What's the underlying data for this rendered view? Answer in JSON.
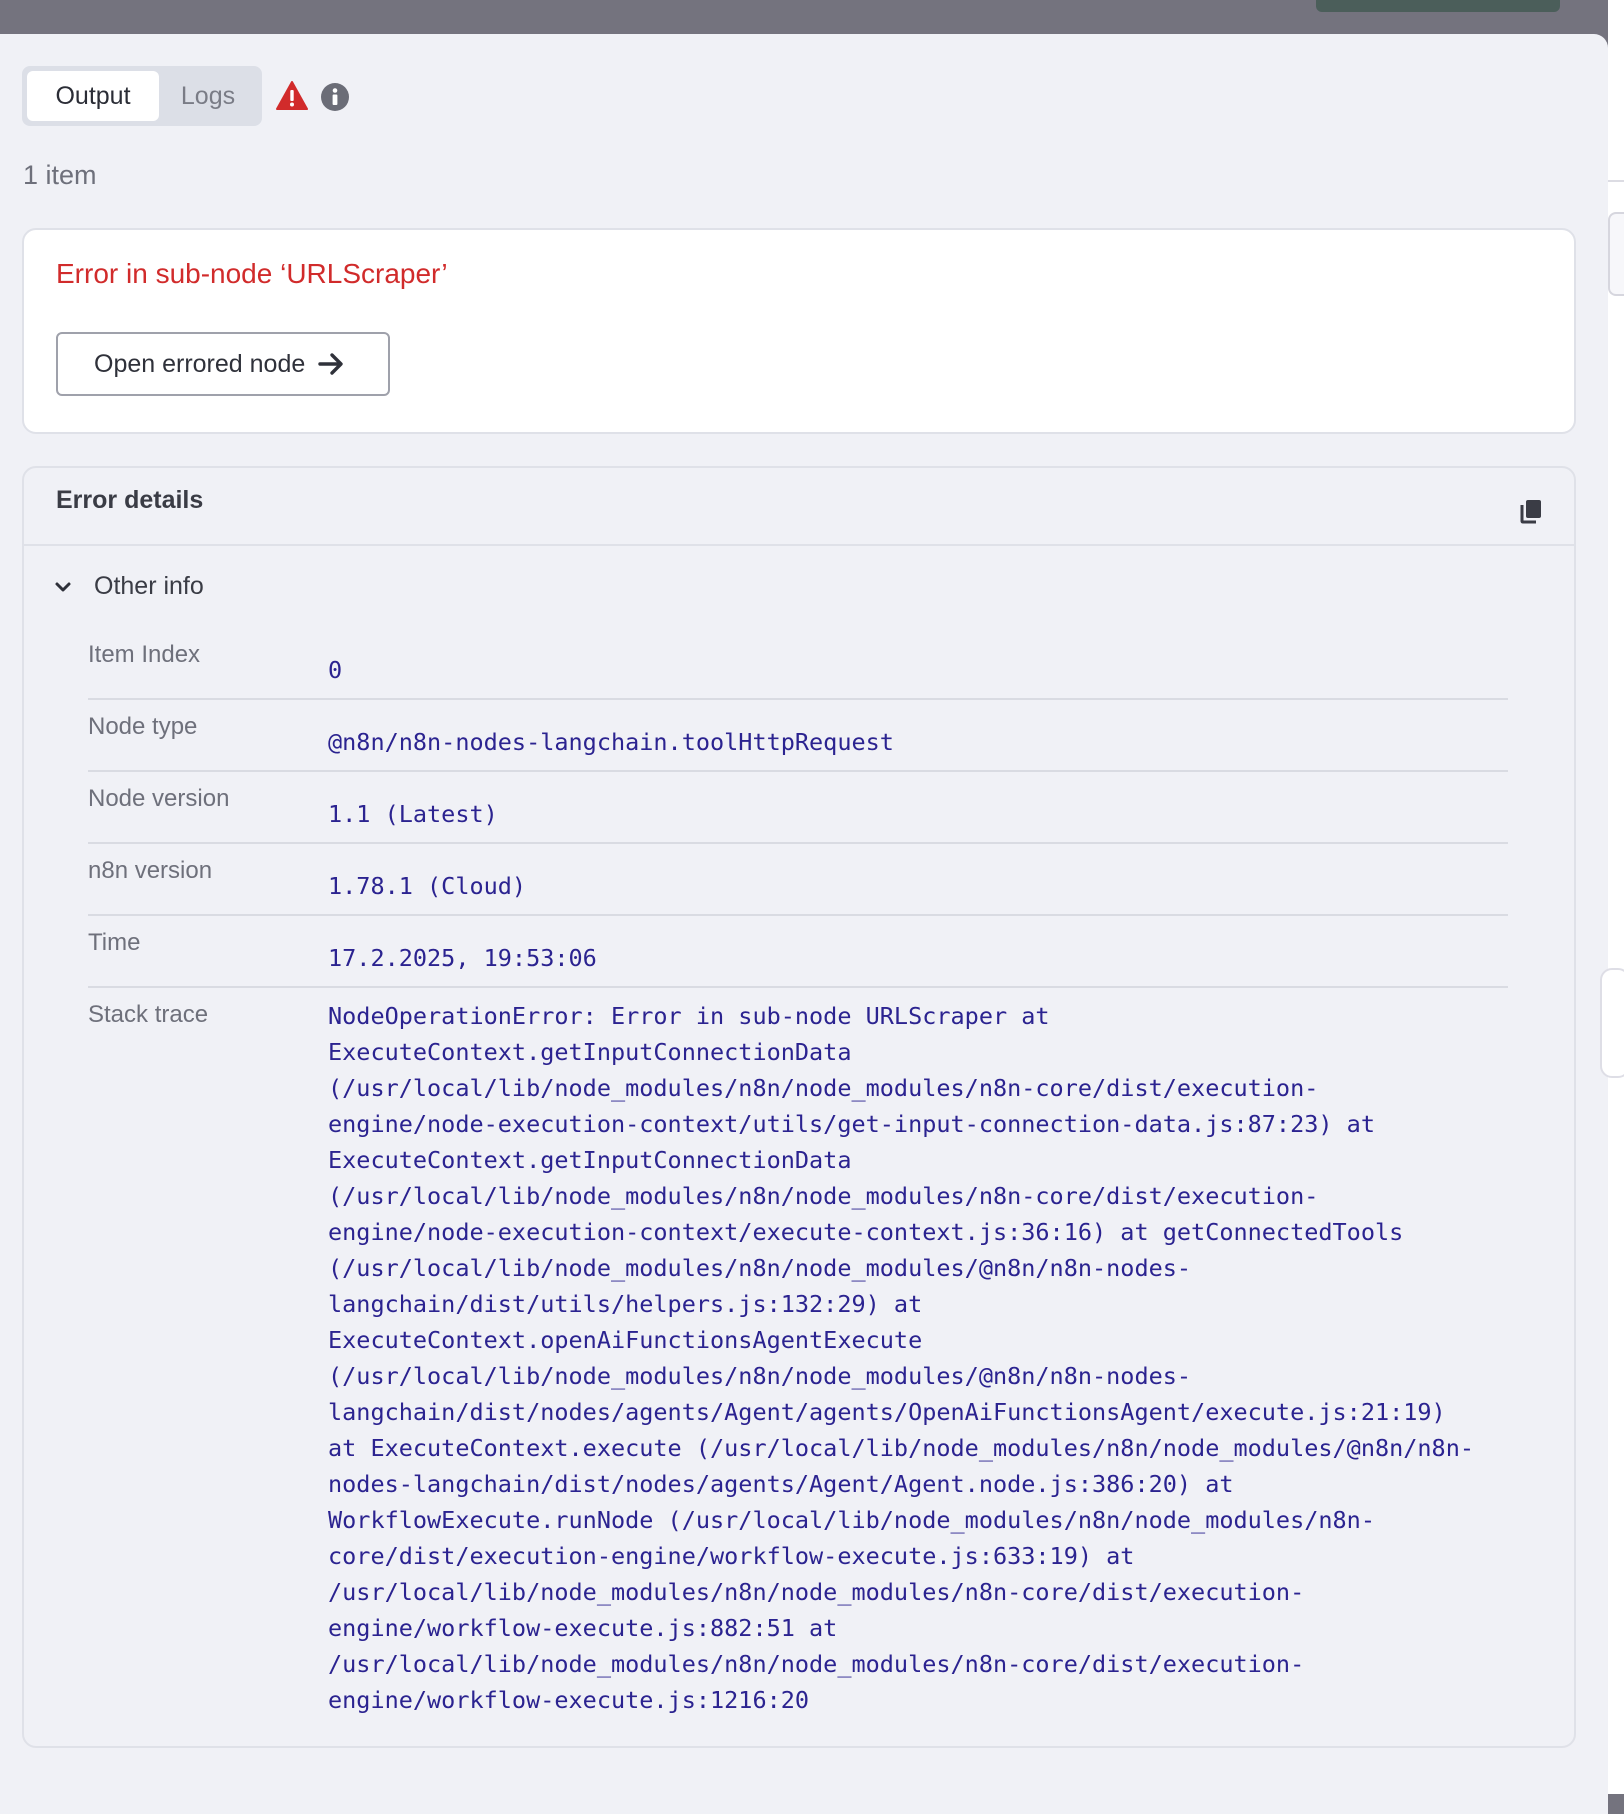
{
  "tabs": {
    "output": "Output",
    "logs": "Logs"
  },
  "item_count": "1 item",
  "error": {
    "title": "Error in sub-node ‘URLScraper’",
    "open_button": "Open errored node"
  },
  "details": {
    "title": "Error details",
    "section_label": "Other info",
    "rows": [
      {
        "label": "Item Index",
        "value": "0"
      },
      {
        "label": "Node type",
        "value": "@n8n/n8n-nodes-langchain.toolHttpRequest"
      },
      {
        "label": "Node version",
        "value": "1.1 (Latest)"
      },
      {
        "label": "n8n version",
        "value": "1.78.1 (Cloud)"
      },
      {
        "label": "Time",
        "value": "17.2.2025, 19:53:06"
      },
      {
        "label": "Stack trace",
        "value": "NodeOperationError: Error in sub-node URLScraper at\nExecuteContext.getInputConnectionData\n(/usr/local/lib/node_modules/n8n/node_modules/n8n-core/dist/execution-\nengine/node-execution-context/utils/get-input-connection-data.js:87:23) at\nExecuteContext.getInputConnectionData\n(/usr/local/lib/node_modules/n8n/node_modules/n8n-core/dist/execution-\nengine/node-execution-context/execute-context.js:36:16) at getConnectedTools\n(/usr/local/lib/node_modules/n8n/node_modules/@n8n/n8n-nodes-\nlangchain/dist/utils/helpers.js:132:29) at\nExecuteContext.openAiFunctionsAgentExecute\n(/usr/local/lib/node_modules/n8n/node_modules/@n8n/n8n-nodes-\nlangchain/dist/nodes/agents/Agent/agents/OpenAiFunctionsAgent/execute.js:21:19)\nat ExecuteContext.execute (/usr/local/lib/node_modules/n8n/node_modules/@n8n/n8n-\nnodes-langchain/dist/nodes/agents/Agent/Agent.node.js:386:20) at\nWorkflowExecute.runNode (/usr/local/lib/node_modules/n8n/node_modules/n8n-\ncore/dist/execution-engine/workflow-execute.js:633:19) at\n/usr/local/lib/node_modules/n8n/node_modules/n8n-core/dist/execution-\nengine/workflow-execute.js:882:51 at\n/usr/local/lib/node_modules/n8n/node_modules/n8n-core/dist/execution-\nengine/workflow-execute.js:1216:20"
      }
    ]
  },
  "colors": {
    "error_red": "#d12b2b",
    "value_blue": "#2b2390",
    "panel_bg": "#f0f1f6"
  },
  "icons": {
    "warning": "warning-triangle-icon",
    "info": "info-circle-icon",
    "arrow": "arrow-right-icon",
    "copy": "copy-icon",
    "chevron": "chevron-down-icon"
  }
}
